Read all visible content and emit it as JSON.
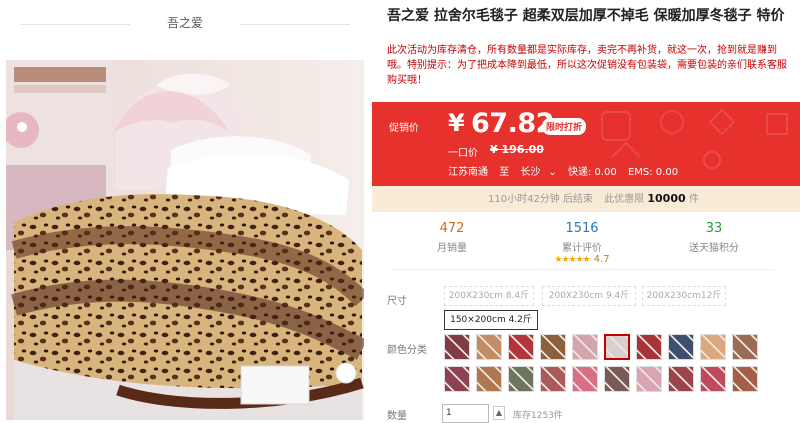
{
  "shop": {
    "name": "吾之爱"
  },
  "product": {
    "title": "吾之爱 拉舍尔毛毯子 超柔双层加厚不掉毛 保暖加厚冬毯子 特价",
    "description": "此次活动为库存清仓，所有数量都是实际库存，卖完不再补货，就这一次，抢到就是赚到哦。特别提示：为了把成本降到最低，所以这次促销没有包装袋，需要包装的亲们联系客服购买哦！"
  },
  "price": {
    "label": "促销价",
    "symbol": "¥",
    "value": "67.82",
    "badge": "限时打折",
    "original_label": "一口价",
    "original_value": "¥ 196.00"
  },
  "shipping": {
    "from": "江苏南通",
    "to_label": "至",
    "to": "长沙",
    "express": "快递: 0.00",
    "ems": "EMS: 0.00"
  },
  "promo": {
    "countdown": "110小时42分钟 后结束",
    "stock_label": "此优惠限",
    "stock": "10000",
    "unit": "件"
  },
  "stats": {
    "sales": {
      "value": "472",
      "label": "月销量"
    },
    "reviews": {
      "value": "1516",
      "label": "累计评价",
      "stars": "★★★★★",
      "rating": "4.7"
    },
    "points": {
      "value": "33",
      "label": "送天猫积分"
    }
  },
  "options": {
    "size_label": "尺寸",
    "sizes": [
      "200X230cm 8.4斤",
      "200X230cm 9.4斤",
      "200X230cm12斤",
      "150×200cm 4.2斤"
    ],
    "color_label": "颜色分类",
    "colors": [
      "#7f3c45",
      "#c28d65",
      "#b4343b",
      "#8e5f3d",
      "#d4a4ad",
      "#d7d0cc",
      "#a63439",
      "#3d4f6f",
      "#dba77c",
      "#9c6b55",
      "#8b4352",
      "#b17652",
      "#6b7560",
      "#ab5a5a",
      "#d96f86",
      "#7a5a57",
      "#d9a4b3",
      "#9b4449",
      "#c04960",
      "#a55e47"
    ]
  },
  "quantity": {
    "label": "数量",
    "value": "1",
    "stepper_up": "▲",
    "stock": "库存1253件"
  },
  "colors": {
    "accent": "#e6312d",
    "highlight": "#c40000"
  }
}
